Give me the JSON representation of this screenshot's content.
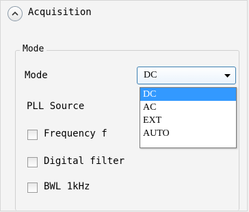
{
  "header": {
    "title": "Acquisition"
  },
  "group": {
    "legend": "Mode"
  },
  "mode": {
    "label": "Mode",
    "selected": "DC",
    "options": [
      "DC",
      "AC",
      "EXT",
      "AUTO"
    ]
  },
  "pll": {
    "label": "PLL Source"
  },
  "checkboxes": [
    {
      "label": "Frequency f",
      "checked": false
    },
    {
      "label": "Digital filter",
      "checked": false
    },
    {
      "label": "BWL 1kHz",
      "checked": false
    }
  ],
  "colors": {
    "selection": "#3399ff",
    "select_border": "#3c7fb1"
  }
}
